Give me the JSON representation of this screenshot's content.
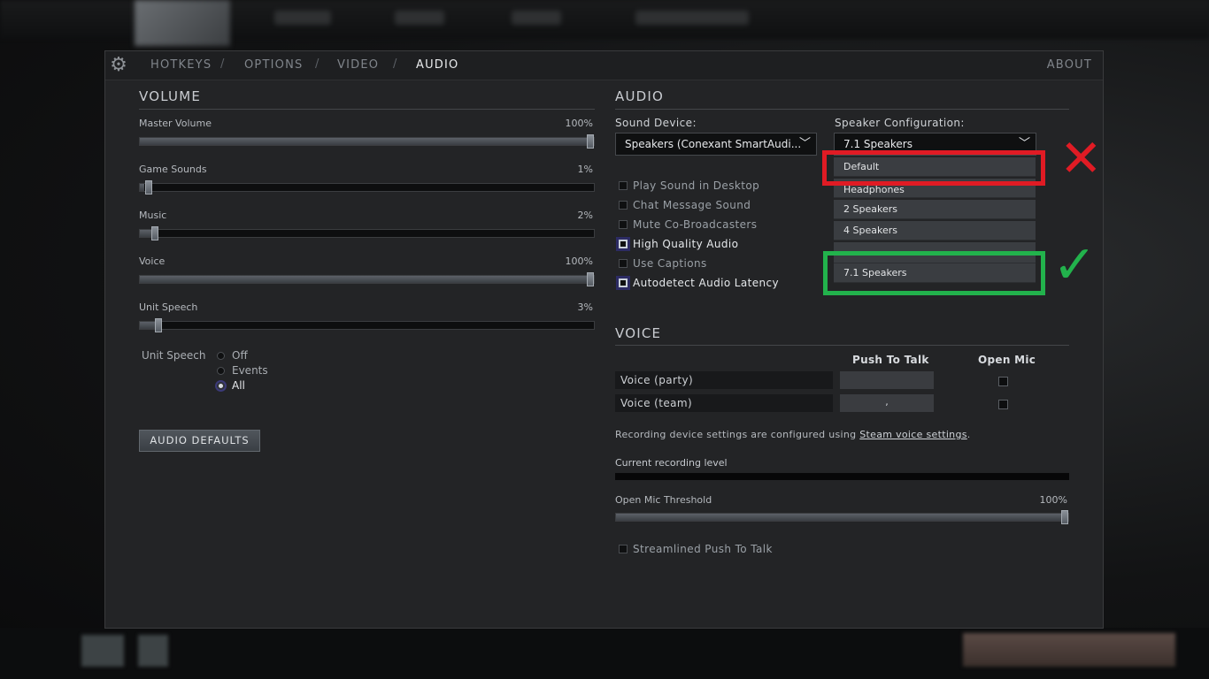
{
  "nav": {
    "tabs": [
      "HOTKEYS",
      "OPTIONS",
      "VIDEO",
      "AUDIO"
    ],
    "separator": "/",
    "active_tab": "AUDIO",
    "about": "ABOUT"
  },
  "volume": {
    "title": "VOLUME",
    "sliders": [
      {
        "label": "Master Volume",
        "value": "100%",
        "level": 1.0
      },
      {
        "label": "Game Sounds",
        "value": "1%",
        "level": 0.01
      },
      {
        "label": "Music",
        "value": "2%",
        "level": 0.02
      },
      {
        "label": "Voice",
        "value": "100%",
        "level": 1.0
      },
      {
        "label": "Unit Speech",
        "value": "3%",
        "level": 0.03
      }
    ],
    "unit_speech_label": "Unit Speech",
    "unit_speech_options": [
      "Off",
      "Events",
      "All"
    ],
    "unit_speech_selected": "All",
    "defaults_button": "AUDIO DEFAULTS"
  },
  "audio": {
    "title": "AUDIO",
    "sound_device_label": "Sound Device:",
    "sound_device_value": "Speakers (Conexant SmartAudio HD)",
    "sound_device_display": "Speakers (Conexant SmartAudi...",
    "speaker_config_label": "Speaker Configuration:",
    "speaker_config_value": "7.1 Speakers",
    "speaker_options": [
      "Default",
      "Headphones",
      "2 Speakers",
      "4 Speakers",
      "7.1 Speakers"
    ],
    "checkboxes": [
      {
        "label": "Play Sound in Desktop",
        "checked": false
      },
      {
        "label": "Chat Message Sound",
        "checked": false
      },
      {
        "label": "Mute Co-Broadcasters",
        "checked": false
      },
      {
        "label": "High Quality Audio",
        "checked": true
      },
      {
        "label": "Use Captions",
        "checked": false
      },
      {
        "label": "Autodetect Audio Latency",
        "checked": true
      }
    ]
  },
  "voice": {
    "title": "VOICE",
    "col_push": "Push To Talk",
    "col_open": "Open Mic",
    "rows": [
      {
        "label": "Voice (party)",
        "key": ""
      },
      {
        "label": "Voice (team)",
        "key": ","
      }
    ],
    "note_prefix": "Recording device settings are configured using ",
    "note_link": "Steam voice settings",
    "note_suffix": ".",
    "rec_level_label": "Current recording level",
    "threshold_label": "Open Mic Threshold",
    "threshold_value": "100%",
    "threshold_level": 1.0,
    "streamlined_label": "Streamlined Push To Talk"
  },
  "annotations": {
    "wrong_mark": "✕",
    "right_mark": "✓",
    "wrong_color": "#e01b24",
    "right_color": "#22b24c"
  }
}
